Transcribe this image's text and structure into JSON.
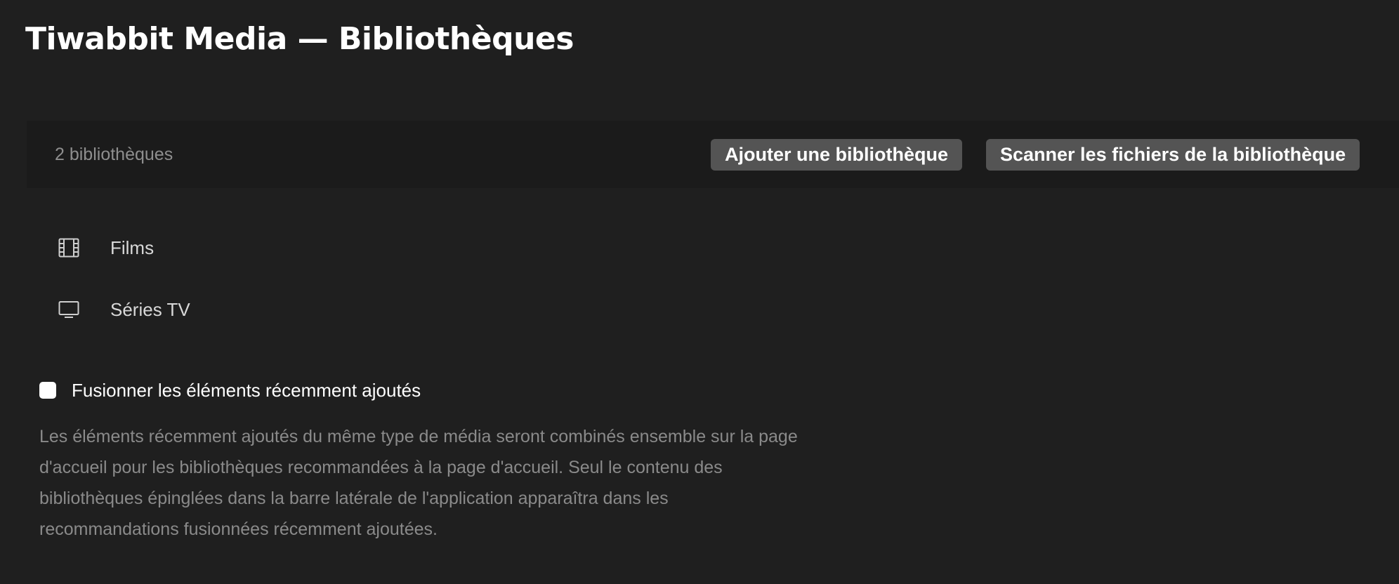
{
  "header": {
    "title": "Tiwabbit Media — Bibliothèques"
  },
  "toolbar": {
    "library_count": "2 bibliothèques",
    "add_library_label": "Ajouter une bibliothèque",
    "scan_library_label": "Scanner les fichiers de la bibliothèque"
  },
  "libraries": [
    {
      "label": "Films",
      "icon": "film-icon"
    },
    {
      "label": "Séries TV",
      "icon": "tv-icon"
    }
  ],
  "merge": {
    "label": "Fusionner les éléments récemment ajoutés",
    "checked": false,
    "description_lines": [
      "Les éléments récemment ajoutés du même type de média seront combinés ensemble sur la page",
      "d'accueil pour les bibliothèques recommandées à la page d'accueil. Seul le contenu des",
      "bibliothèques épinglées dans la barre latérale de l'application apparaîtra dans les",
      "recommandations fusionnées récemment ajoutées."
    ]
  },
  "colors": {
    "background": "#1f1f1f",
    "toolbar_background": "#1b1b1b",
    "button_background": "#545454",
    "muted_text": "#8a8a8a"
  }
}
